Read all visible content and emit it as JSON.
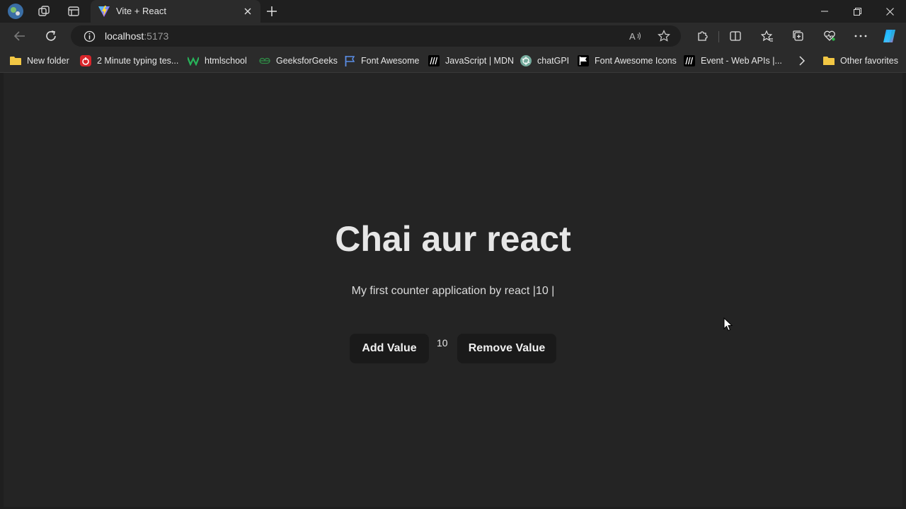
{
  "browser": {
    "tab": {
      "title": "Vite + React"
    },
    "url": {
      "host": "localhost",
      "port": ":5173"
    },
    "bookmarks": [
      {
        "label": "New folder",
        "icon": "folder-icon"
      },
      {
        "label": "2 Minute typing tes...",
        "icon": "typing-test-icon"
      },
      {
        "label": "htmlschool",
        "icon": "htmlschool-icon"
      },
      {
        "label": "GeeksforGeeks",
        "icon": "geeksforgeeks-icon"
      },
      {
        "label": "Font Awesome",
        "icon": "font-awesome-flag-icon"
      },
      {
        "label": "JavaScript | MDN",
        "icon": "mdn-icon"
      },
      {
        "label": "chatGPI",
        "icon": "chatgpt-icon"
      },
      {
        "label": "Font Awesome Icons",
        "icon": "font-awesome-flag-icon"
      },
      {
        "label": "Event - Web APIs |...",
        "icon": "mdn-icon"
      }
    ],
    "other_favorites": "Other favorites"
  },
  "page": {
    "heading": "Chai aur react",
    "subtitle": "My first counter application by react |10 |",
    "add_label": "Add Value",
    "count": "10",
    "remove_label": "Remove Value"
  },
  "colors": {
    "page_bg": "#242424",
    "chrome_bg": "#2b2b2b",
    "button_bg": "#1a1a1a",
    "text": "#e6e6e6"
  }
}
